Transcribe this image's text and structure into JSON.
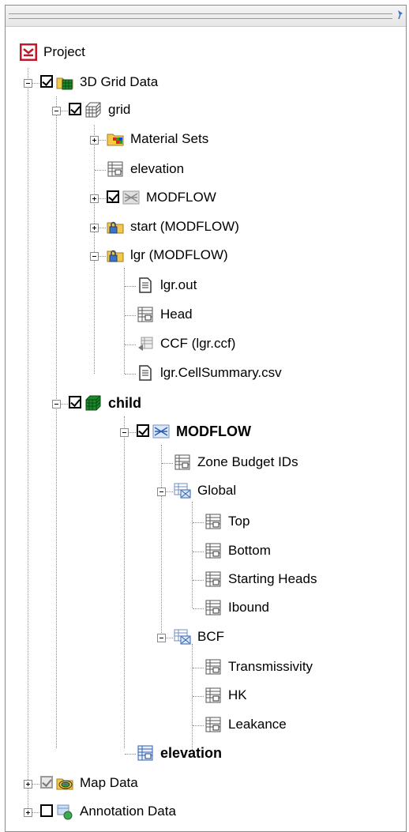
{
  "tree": {
    "project": "Project",
    "grid3d": "3D Grid Data",
    "grid": "grid",
    "material_sets": "Material Sets",
    "elevation_grid": "elevation",
    "modflow_grid": "MODFLOW",
    "start_modflow": "start (MODFLOW)",
    "lgr_modflow": "lgr (MODFLOW)",
    "lgr_out": "lgr.out",
    "head": "Head",
    "ccf": "CCF (lgr.ccf)",
    "cell_summary": "lgr.CellSummary.csv",
    "child": "child",
    "modflow_child": "MODFLOW",
    "zone_budget": "Zone Budget IDs",
    "global": "Global",
    "top": "Top",
    "bottom": "Bottom",
    "starting_heads": "Starting Heads",
    "ibound": "Ibound",
    "bcf": "BCF",
    "transmissivity": "Transmissivity",
    "hk": "HK",
    "leakance": "Leakance",
    "elevation_child": "elevation",
    "map_data": "Map Data",
    "annotation_data": "Annotation Data"
  },
  "colors": {
    "project_icon": "#c0182a",
    "folder": "#f5c84a",
    "grid_green": "#1c8a2a",
    "modflow_blue": "#2d5fb0"
  }
}
